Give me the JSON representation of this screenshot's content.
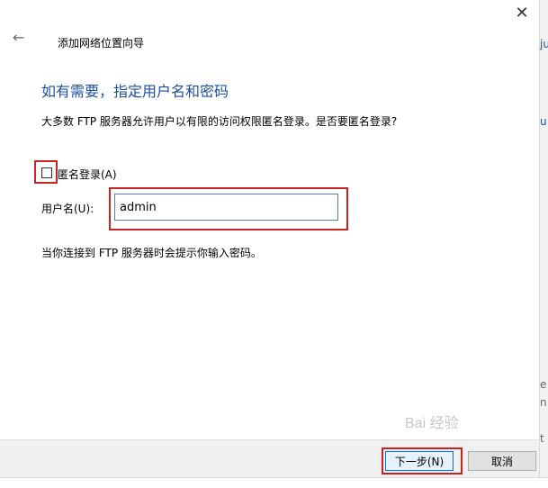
{
  "window": {
    "title": "添加网络位置向导",
    "close_glyph": "✕",
    "back_glyph": "←"
  },
  "content": {
    "heading": "如有需要，指定用户名和密码",
    "description": "大多数 FTP 服务器允许用户以有限的访问权限匿名登录。是否要匿名登录?",
    "anonymous_checkbox_label": "匿名登录(A)",
    "username_label": "用户名(U):",
    "username_value": "admin",
    "note": "当你连接到 FTP 服务器时会提示你输入密码。"
  },
  "footer": {
    "next_label": "下一步(N)",
    "cancel_label": "取消"
  },
  "watermark": {
    "text": "Bai 经验"
  },
  "side": {
    "frag1": "ju",
    "frag2": "u",
    "frag3": "e",
    "frag4": "n",
    "frag5": "t"
  },
  "colors": {
    "heading": "#1e4f9e",
    "highlight": "#cc2222",
    "input_border": "#4a7fc1"
  }
}
